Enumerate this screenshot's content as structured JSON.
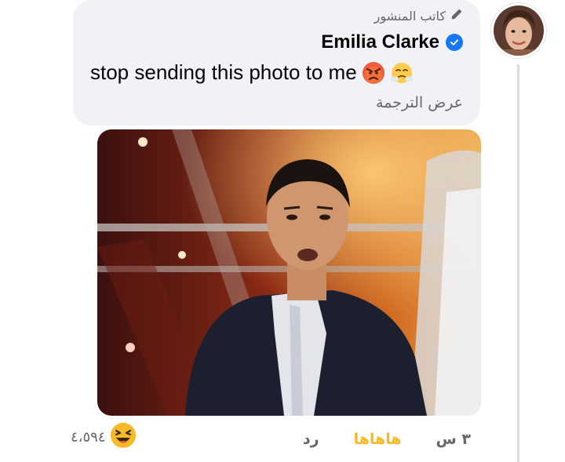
{
  "comment": {
    "author_badge": "كاتب المنشور",
    "author_badge_icon": "pencil-icon",
    "author_name": "Emilia Clarke",
    "verified_icon": "verified-badge-icon",
    "message": "stop sending this photo to me",
    "message_emojis": [
      "angry-face-icon",
      "face-with-steam-icon"
    ],
    "see_translation": "عرض الترجمة",
    "photo": "attached-photo"
  },
  "actions": {
    "time": "٣ س",
    "reaction_label": "هاهاها",
    "reply_label": "رد"
  },
  "reactions": {
    "icon": "haha-reaction-icon",
    "count": "٤،٥٩٤"
  },
  "colors": {
    "bubble": "#f0f2f5",
    "haha_accent": "#f7b928",
    "verified": "#1877f2",
    "muted_text": "#65676b"
  }
}
